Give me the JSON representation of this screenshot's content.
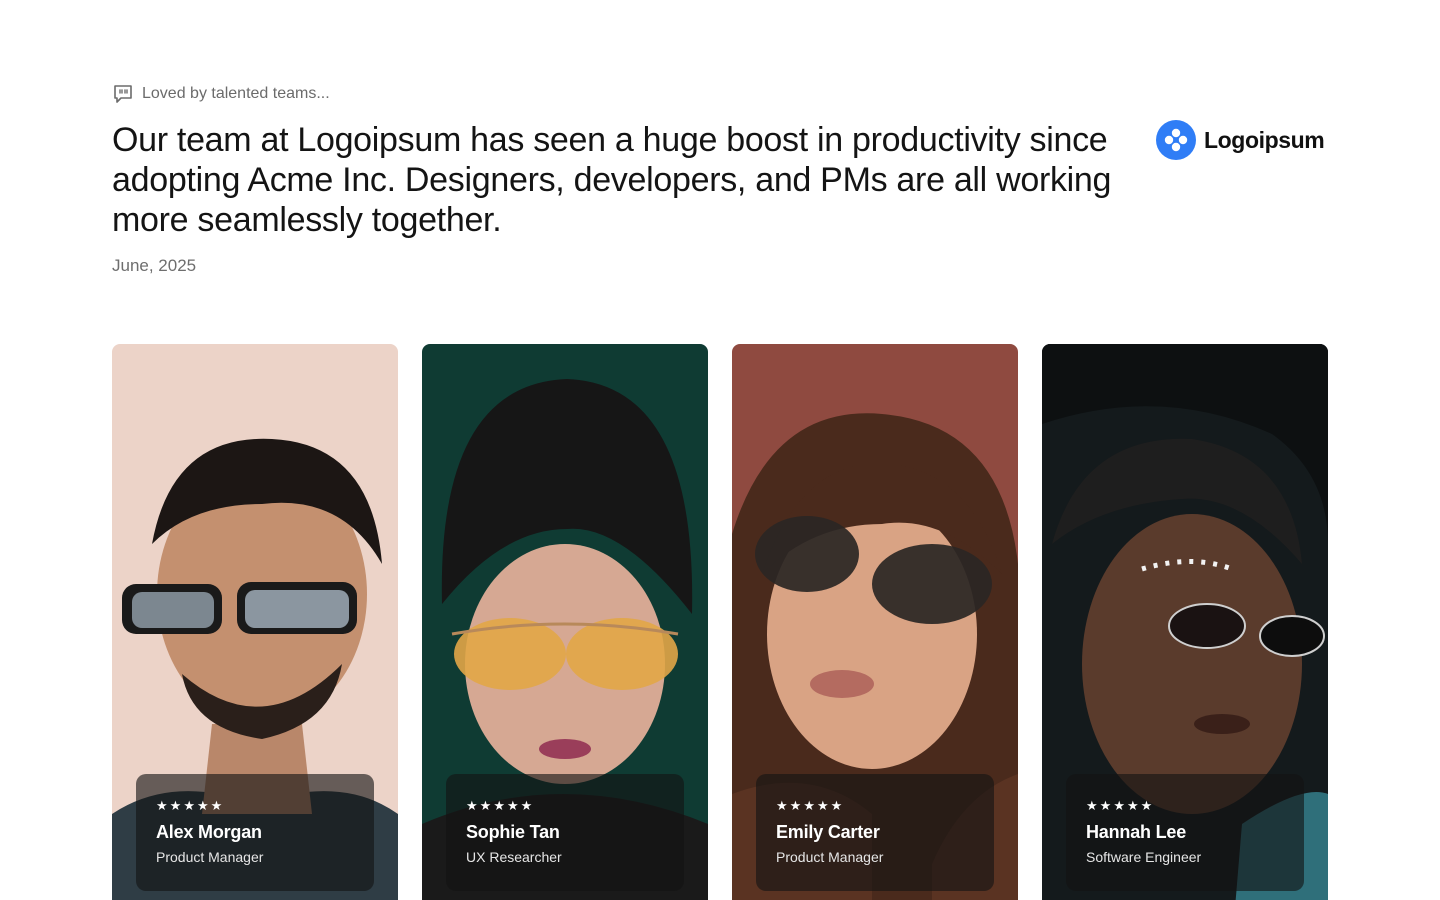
{
  "eyebrow": {
    "icon": "quote-bubble-icon",
    "text": "Loved by talented teams..."
  },
  "testimonial": {
    "quote": "Our team at Logoipsum has seen a huge boost in productivity since adopting Acme Inc. Designers, developers, and PMs are all working more seamlessly together.",
    "date": "June, 2025"
  },
  "brand": {
    "name": "Logoipsum",
    "icon": "logoipsum-logo-icon",
    "color": "#2f7df6"
  },
  "team": [
    {
      "name": "Alex Morgan",
      "role": "Product Manager",
      "rating": "★★★★★",
      "background": "#ecd3c8"
    },
    {
      "name": "Sophie Tan",
      "role": "UX Researcher",
      "rating": "★★★★★",
      "background": "#0f3b33"
    },
    {
      "name": "Emily Carter",
      "role": "Product Manager",
      "rating": "★★★★★",
      "background": "#8f4a40"
    },
    {
      "name": "Hannah Lee",
      "role": "Software Engineer",
      "rating": "★★★★★",
      "background": "#141a1c"
    }
  ]
}
